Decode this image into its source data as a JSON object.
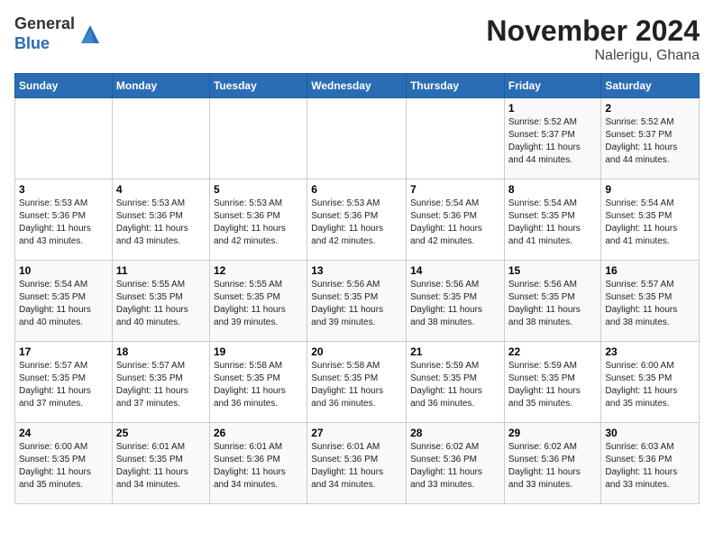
{
  "header": {
    "logo_line1": "General",
    "logo_line2": "Blue",
    "month": "November 2024",
    "location": "Nalerigu, Ghana"
  },
  "weekdays": [
    "Sunday",
    "Monday",
    "Tuesday",
    "Wednesday",
    "Thursday",
    "Friday",
    "Saturday"
  ],
  "weeks": [
    [
      {
        "day": "",
        "info": ""
      },
      {
        "day": "",
        "info": ""
      },
      {
        "day": "",
        "info": ""
      },
      {
        "day": "",
        "info": ""
      },
      {
        "day": "",
        "info": ""
      },
      {
        "day": "1",
        "info": "Sunrise: 5:52 AM\nSunset: 5:37 PM\nDaylight: 11 hours\nand 44 minutes."
      },
      {
        "day": "2",
        "info": "Sunrise: 5:52 AM\nSunset: 5:37 PM\nDaylight: 11 hours\nand 44 minutes."
      }
    ],
    [
      {
        "day": "3",
        "info": "Sunrise: 5:53 AM\nSunset: 5:36 PM\nDaylight: 11 hours\nand 43 minutes."
      },
      {
        "day": "4",
        "info": "Sunrise: 5:53 AM\nSunset: 5:36 PM\nDaylight: 11 hours\nand 43 minutes."
      },
      {
        "day": "5",
        "info": "Sunrise: 5:53 AM\nSunset: 5:36 PM\nDaylight: 11 hours\nand 42 minutes."
      },
      {
        "day": "6",
        "info": "Sunrise: 5:53 AM\nSunset: 5:36 PM\nDaylight: 11 hours\nand 42 minutes."
      },
      {
        "day": "7",
        "info": "Sunrise: 5:54 AM\nSunset: 5:36 PM\nDaylight: 11 hours\nand 42 minutes."
      },
      {
        "day": "8",
        "info": "Sunrise: 5:54 AM\nSunset: 5:35 PM\nDaylight: 11 hours\nand 41 minutes."
      },
      {
        "day": "9",
        "info": "Sunrise: 5:54 AM\nSunset: 5:35 PM\nDaylight: 11 hours\nand 41 minutes."
      }
    ],
    [
      {
        "day": "10",
        "info": "Sunrise: 5:54 AM\nSunset: 5:35 PM\nDaylight: 11 hours\nand 40 minutes."
      },
      {
        "day": "11",
        "info": "Sunrise: 5:55 AM\nSunset: 5:35 PM\nDaylight: 11 hours\nand 40 minutes."
      },
      {
        "day": "12",
        "info": "Sunrise: 5:55 AM\nSunset: 5:35 PM\nDaylight: 11 hours\nand 39 minutes."
      },
      {
        "day": "13",
        "info": "Sunrise: 5:56 AM\nSunset: 5:35 PM\nDaylight: 11 hours\nand 39 minutes."
      },
      {
        "day": "14",
        "info": "Sunrise: 5:56 AM\nSunset: 5:35 PM\nDaylight: 11 hours\nand 38 minutes."
      },
      {
        "day": "15",
        "info": "Sunrise: 5:56 AM\nSunset: 5:35 PM\nDaylight: 11 hours\nand 38 minutes."
      },
      {
        "day": "16",
        "info": "Sunrise: 5:57 AM\nSunset: 5:35 PM\nDaylight: 11 hours\nand 38 minutes."
      }
    ],
    [
      {
        "day": "17",
        "info": "Sunrise: 5:57 AM\nSunset: 5:35 PM\nDaylight: 11 hours\nand 37 minutes."
      },
      {
        "day": "18",
        "info": "Sunrise: 5:57 AM\nSunset: 5:35 PM\nDaylight: 11 hours\nand 37 minutes."
      },
      {
        "day": "19",
        "info": "Sunrise: 5:58 AM\nSunset: 5:35 PM\nDaylight: 11 hours\nand 36 minutes."
      },
      {
        "day": "20",
        "info": "Sunrise: 5:58 AM\nSunset: 5:35 PM\nDaylight: 11 hours\nand 36 minutes."
      },
      {
        "day": "21",
        "info": "Sunrise: 5:59 AM\nSunset: 5:35 PM\nDaylight: 11 hours\nand 36 minutes."
      },
      {
        "day": "22",
        "info": "Sunrise: 5:59 AM\nSunset: 5:35 PM\nDaylight: 11 hours\nand 35 minutes."
      },
      {
        "day": "23",
        "info": "Sunrise: 6:00 AM\nSunset: 5:35 PM\nDaylight: 11 hours\nand 35 minutes."
      }
    ],
    [
      {
        "day": "24",
        "info": "Sunrise: 6:00 AM\nSunset: 5:35 PM\nDaylight: 11 hours\nand 35 minutes."
      },
      {
        "day": "25",
        "info": "Sunrise: 6:01 AM\nSunset: 5:35 PM\nDaylight: 11 hours\nand 34 minutes."
      },
      {
        "day": "26",
        "info": "Sunrise: 6:01 AM\nSunset: 5:36 PM\nDaylight: 11 hours\nand 34 minutes."
      },
      {
        "day": "27",
        "info": "Sunrise: 6:01 AM\nSunset: 5:36 PM\nDaylight: 11 hours\nand 34 minutes."
      },
      {
        "day": "28",
        "info": "Sunrise: 6:02 AM\nSunset: 5:36 PM\nDaylight: 11 hours\nand 33 minutes."
      },
      {
        "day": "29",
        "info": "Sunrise: 6:02 AM\nSunset: 5:36 PM\nDaylight: 11 hours\nand 33 minutes."
      },
      {
        "day": "30",
        "info": "Sunrise: 6:03 AM\nSunset: 5:36 PM\nDaylight: 11 hours\nand 33 minutes."
      }
    ]
  ]
}
